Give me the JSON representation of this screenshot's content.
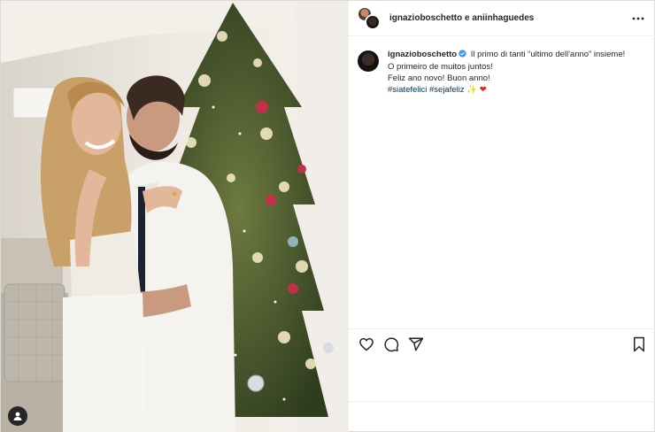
{
  "header": {
    "names": "ignazioboschetto e aniinhaguedes"
  },
  "caption": {
    "username": "ignazioboschetto",
    "line1": "Il primo di tanti “ultimo dell'anno” insieme!",
    "line2": "O primeiro de muitos juntos!",
    "line3": "Feliz ano novo! Buon anno!",
    "hashtag1": "#siatefelici",
    "hashtag2": "#sejafeliz",
    "emoji_sparkle": "✨",
    "emoji_heart": "❤"
  },
  "icons": {
    "more": "more-options-icon",
    "like": "heart-icon",
    "comment": "comment-icon",
    "share": "share-icon",
    "save": "bookmark-icon",
    "tag": "user-tag-icon",
    "verified": "verified-badge-icon"
  },
  "colors": {
    "verified": "#3897f0",
    "hashtag": "#00376b",
    "heart": "#ed1c24"
  }
}
